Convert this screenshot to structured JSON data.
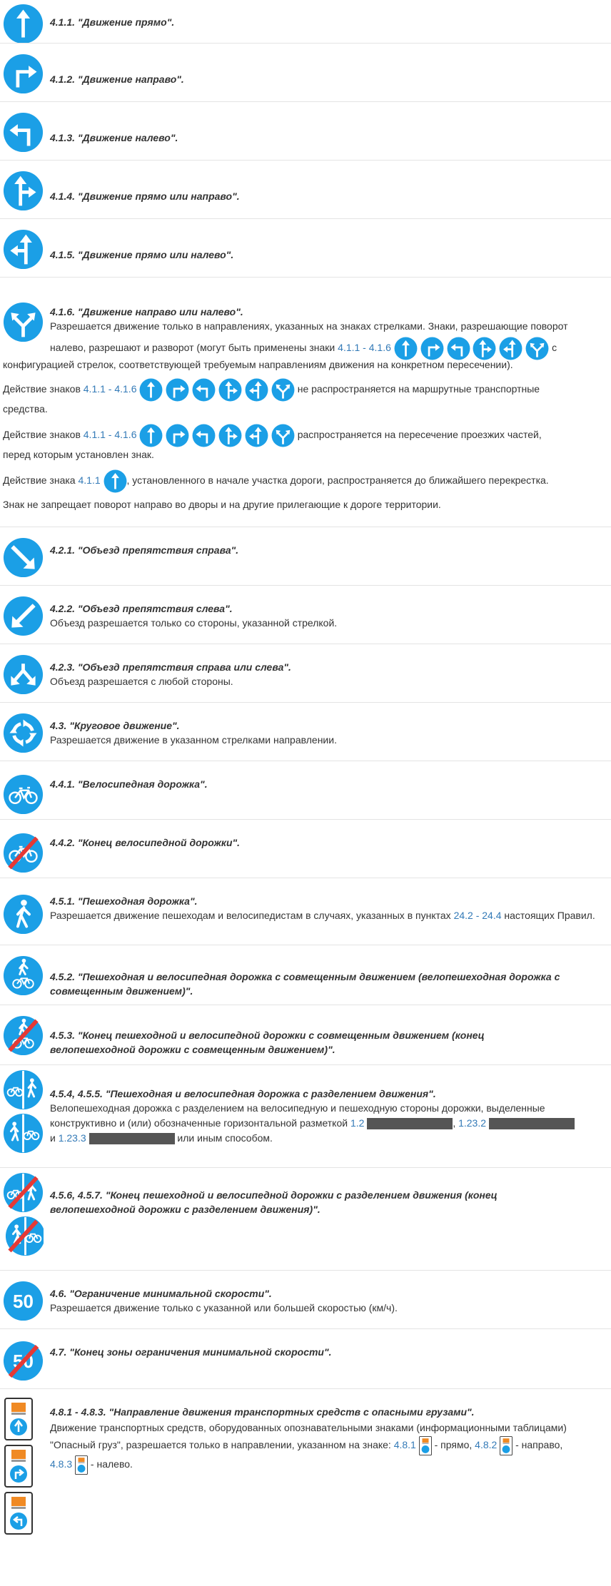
{
  "colors": {
    "sign_blue": "#1b9fe6",
    "sign_red": "#e53935",
    "link": "#337ab7",
    "text": "#333333",
    "hazard_orange": "#f08a24"
  },
  "sections": {
    "s411": {
      "title": "4.1.1. \"Движение прямо\"."
    },
    "s412": {
      "title": "4.1.2. \"Движение направо\"."
    },
    "s413": {
      "title": "4.1.3. \"Движение налево\"."
    },
    "s414": {
      "title": "4.1.4. \"Движение прямо или направо\"."
    },
    "s415": {
      "title": "4.1.5. \"Движение прямо или налево\"."
    },
    "s416": {
      "title": "4.1.6. \"Движение направо или налево\".",
      "desc_a": "Разрешается движение только в направлениях, указанных на знаках стрелками. Знаки, разрешающие поворот налево, разрешают и разворот (могут быть применены знаки ",
      "desc_link": "4.1.1 - 4.1.6",
      "desc_b": " с конфигурацией стрелок, соответствующей требуемым направлениям движения на конкретном пересечении).",
      "p1_a": "Действие знаков ",
      "p1_link": "4.1.1 - 4.1.6",
      "p1_b": " не распространяется на маршрутные транспортные средства.",
      "p2_a": "Действие знаков ",
      "p2_link": "4.1.1 - 4.1.6",
      "p2_b": " распространяется на пересечение проезжих частей, перед которым установлен знак.",
      "p3_a": "Действие знака ",
      "p3_link": "4.1.1",
      "p3_b": ", установленного в начале участка дороги, распространяется до ближайшего перекрестка.",
      "p4": "Знак не запрещает поворот направо во дворы и на другие прилегающие к дороге территории."
    },
    "s421": {
      "title": "4.2.1. \"Объезд препятствия справа\"."
    },
    "s422": {
      "title": "4.2.2. \"Объезд препятствия слева\".",
      "desc": "Объезд разрешается только со стороны, указанной стрелкой."
    },
    "s423": {
      "title": "4.2.3. \"Объезд препятствия справа или слева\".",
      "desc": "Объезд разрешается с любой стороны."
    },
    "s43": {
      "title": "4.3. \"Круговое движение\".",
      "desc": "Разрешается движение в указанном стрелками направлении."
    },
    "s441": {
      "title": "4.4.1. \"Велосипедная дорожка\"."
    },
    "s442": {
      "title": "4.4.2. \"Конец велосипедной дорожки\"."
    },
    "s451": {
      "title": "4.5.1. \"Пешеходная дорожка\".",
      "desc_a": "Разрешается движение пешеходам и велосипедистам в случаях, указанных в пунктах ",
      "desc_link": "24.2 - 24.4",
      "desc_b": " настоящих Правил."
    },
    "s452": {
      "title_1": "4.5.2. \"Пешеходная и велосипедная дорожка с совмещенным движением (велопешеходная дорожка с",
      "title_2": "совмещенным движением)\"."
    },
    "s453": {
      "title_1": "4.5.3. \"Конец пешеходной и велосипедной дорожки с совмещенным движением (конец",
      "title_2": "велопешеходной дорожки с совмещенным движением)\"."
    },
    "s454": {
      "title": "4.5.4, 4.5.5. \"Пешеходная и велосипедная дорожка с разделением движения\".",
      "desc_a": "Велопешеходная дорожка с разделением на велосипедную и пешеходную стороны дорожки, выделенные конструктивно и (или) обозначенные горизонтальной разметкой ",
      "link_1": "1.2",
      "sep": ", ",
      "link_2": "1.23.2",
      "mid": " и ",
      "link_3": "1.23.3",
      "desc_b": " или иным способом."
    },
    "s456": {
      "title_1": "4.5.6, 4.5.7. \"Конец пешеходной и велосипедной дорожки с разделением движения (конец",
      "title_2": "велопешеходной дорожки с разделением движения)\"."
    },
    "s46": {
      "title": "4.6. \"Ограничение минимальной скорости\".",
      "desc": "Разрешается движение только с указанной или большей скоростью (км/ч).",
      "sign_text": "50"
    },
    "s47": {
      "title": "4.7. \"Конец зоны ограничения минимальной скорости\".",
      "sign_text": "50"
    },
    "s48": {
      "title": "4.8.1 - 4.8.3. \"Направление движения транспортных средств с опасными грузами\".",
      "desc_a": "Движение транспортных средств, оборудованных опознавательными знаками (информационными таблицами) \"Опасный груз\", разрешается только в направлении, указанном на знаке: ",
      "link_1": "4.8.1",
      "t1": " - прямо, ",
      "link_2": "4.8.2",
      "t2": " - направо, ",
      "link_3": "4.8.3",
      "t3": " - налево."
    }
  }
}
